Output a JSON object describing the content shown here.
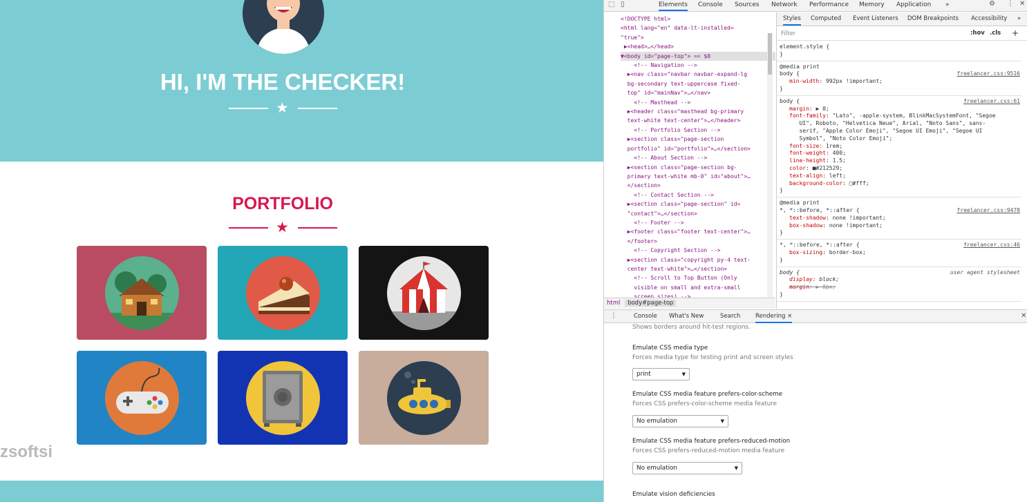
{
  "page": {
    "masthead_title": "HI, I'M THE CHECKER!",
    "portfolio_title": "PORTFOLIO",
    "watermark": "zsoftsi",
    "tiles": [
      {
        "name": "cabin",
        "bg": "#b94c62",
        "circle": "#5bb08e"
      },
      {
        "name": "cake",
        "bg": "#23a6b6",
        "circle": "#e05a47"
      },
      {
        "name": "circus",
        "bg": "#141414",
        "circle": "#e7e7e7"
      },
      {
        "name": "game",
        "bg": "#2184c4",
        "circle": "#e07a3a"
      },
      {
        "name": "safe",
        "bg": "#1234b3",
        "circle": "#f1c53a"
      },
      {
        "name": "submarine",
        "bg": "#c8ac9c",
        "circle": "#2c3e50"
      }
    ],
    "colors": {
      "masthead": "#7ccdd3",
      "accent": "#d8174d"
    }
  },
  "devtools": {
    "tabs": [
      "Elements",
      "Console",
      "Sources",
      "Network",
      "Performance",
      "Memory",
      "Application",
      "»"
    ],
    "active_tab": "Elements",
    "elements_lines": [
      {
        "t": "<!DOCTYPE html>",
        "c": "gray"
      },
      {
        "t": "<html lang=\"en\" data-lt-installed=",
        "c": "tag"
      },
      {
        "t": "\"true\">",
        "c": "tag"
      },
      {
        "t": " ▶<head>…</head>",
        "c": "tag"
      },
      {
        "t": "▼<body id=\"page-top\"> == $0",
        "c": "tag",
        "selected": true
      },
      {
        "t": "    <!-- Navigation -->",
        "c": "comment"
      },
      {
        "t": "  ▶<nav class=\"navbar navbar-expand-lg",
        "c": "tag"
      },
      {
        "t": "  bg-secondary text-uppercase fixed-",
        "c": "val"
      },
      {
        "t": "  top\" id=\"mainNav\">…</nav>",
        "c": "tag"
      },
      {
        "t": "    <!-- Masthead -->",
        "c": "comment"
      },
      {
        "t": "  ▶<header class=\"masthead bg-primary",
        "c": "tag"
      },
      {
        "t": "  text-white text-center\">…</header>",
        "c": "tag"
      },
      {
        "t": "    <!-- Portfolio Section -->",
        "c": "comment"
      },
      {
        "t": "  ▶<section class=\"page-section",
        "c": "tag"
      },
      {
        "t": "  portfolio\" id=\"portfolio\">…</section>",
        "c": "tag"
      },
      {
        "t": "    <!-- About Section -->",
        "c": "comment"
      },
      {
        "t": "  ▶<section class=\"page-section bg-",
        "c": "tag"
      },
      {
        "t": "  primary text-white mb-0\" id=\"about\">…",
        "c": "tag"
      },
      {
        "t": "  </section>",
        "c": "tag"
      },
      {
        "t": "    <!-- Contact Section -->",
        "c": "comment"
      },
      {
        "t": "  ▶<section class=\"page-section\" id=",
        "c": "tag"
      },
      {
        "t": "  \"contact\">…</section>",
        "c": "tag"
      },
      {
        "t": "    <!-- Footer -->",
        "c": "comment"
      },
      {
        "t": "  ▶<footer class=\"footer text-center\">…",
        "c": "tag"
      },
      {
        "t": "  </footer>",
        "c": "tag"
      },
      {
        "t": "    <!-- Copyright Section -->",
        "c": "comment"
      },
      {
        "t": "  ▶<section class=\"copyright py-4 text-",
        "c": "tag"
      },
      {
        "t": "  center text-white\">…</section>",
        "c": "tag"
      },
      {
        "t": "    <!-- Scroll to Top Button (Only",
        "c": "comment"
      },
      {
        "t": "    visible on small and extra-small",
        "c": "comment"
      },
      {
        "t": "    screen sizes) -->",
        "c": "comment"
      }
    ],
    "breadcrumbs": [
      "html",
      "body#page-top"
    ],
    "styles_tabs": [
      "Styles",
      "Computed",
      "Event Listeners",
      "DOM Breakpoints",
      "Accessibility",
      "»"
    ],
    "filter_placeholder": "Filter",
    "filter_buttons": [
      ":hov",
      ".cls",
      "+"
    ],
    "rules": [
      {
        "media": "",
        "selector": "element.style {",
        "src": "",
        "props": []
      },
      {
        "media": "@media print",
        "selector": "body {",
        "src": "freelancer.css:9516",
        "props": [
          "min-width: 992px !important;"
        ]
      },
      {
        "media": "",
        "selector": "body {",
        "src": "freelancer.css:61",
        "props": [
          "margin: ▶ 0;",
          "font-family: \"Lato\", -apple-system, BlinkMacSystemFont, \"Segoe",
          "   UI\", Roboto, \"Helvetica Neue\", Arial, \"Noto Sans\", sans-",
          "   serif, \"Apple Color Emoji\", \"Segoe UI Emoji\", \"Segoe UI",
          "   Symbol\", \"Noto Color Emoji\";",
          "font-size: 1rem;",
          "font-weight: 400;",
          "line-height: 1.5;",
          "color: ■#212529;",
          "text-align: left;",
          "background-color: □#fff;"
        ]
      },
      {
        "media": "@media print",
        "selector": "*, *::before, *::after {",
        "src": "freelancer.css:9478",
        "props": [
          "text-shadow: none !important;",
          "box-shadow: none !important;"
        ]
      },
      {
        "media": "",
        "selector": "*, *::before, *::after {",
        "src": "freelancer.css:46",
        "props": [
          "box-sizing: border-box;"
        ]
      },
      {
        "media": "",
        "selector": "body {",
        "src": "user agent stylesheet",
        "props": [
          "display: block;",
          "margin: ▶ 8px;"
        ]
      }
    ],
    "drawer_tabs": [
      "Console",
      "What's New",
      "Search",
      "Rendering ×"
    ],
    "rendering": {
      "top_desc": "Shows borders around hit-test regions.",
      "sections": [
        {
          "title": "Emulate CSS media type",
          "desc": "Forces media type for testing print and screen styles",
          "value": "print"
        },
        {
          "title": "Emulate CSS media feature prefers-color-scheme",
          "desc": "Forces CSS prefers-color-scheme media feature",
          "value": "No emulation"
        },
        {
          "title": "Emulate CSS media feature prefers-reduced-motion",
          "desc": "Forces CSS prefers-reduced-motion media feature",
          "value": "No emulation"
        },
        {
          "title": "Emulate vision deficiencies",
          "desc": "",
          "value": ""
        }
      ]
    }
  }
}
